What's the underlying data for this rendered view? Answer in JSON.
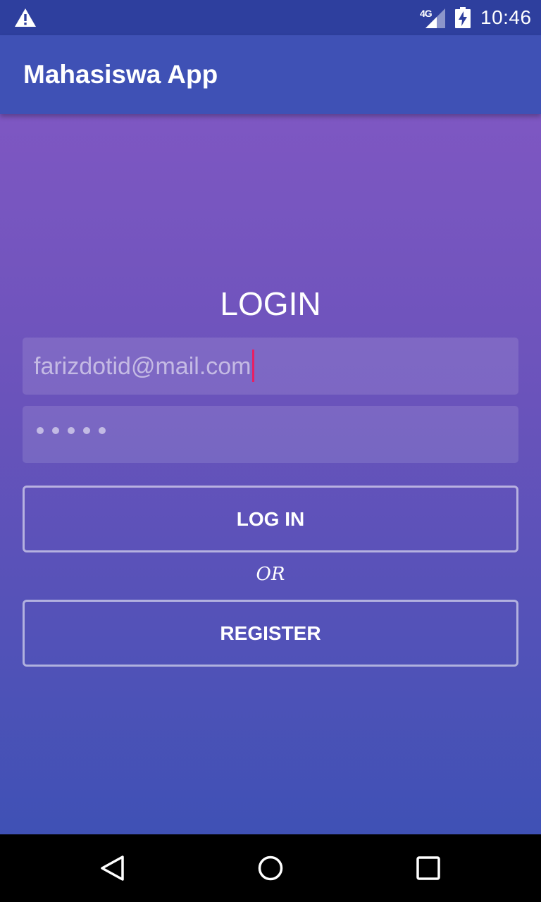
{
  "status_bar": {
    "network_label": "4G",
    "time": "10:46",
    "icons": [
      "warning-icon",
      "signal-icon",
      "battery-charging-icon"
    ]
  },
  "app_bar": {
    "title": "Mahasiswa App"
  },
  "login_form": {
    "heading": "LOGIN",
    "email_value": "farizdotid@mail.com",
    "password_mask_length": 5,
    "login_button": "LOG IN",
    "or_label": "OR",
    "register_button": "REGISTER"
  },
  "nav_bar": {
    "icons": [
      "back-icon",
      "home-icon",
      "recent-apps-icon"
    ]
  },
  "colors": {
    "status_bar": "#2e3f9e",
    "app_bar": "#3f51b5",
    "gradient_top": "#7e57c2",
    "gradient_bottom": "#3f51b5",
    "cursor": "#e91e63"
  }
}
